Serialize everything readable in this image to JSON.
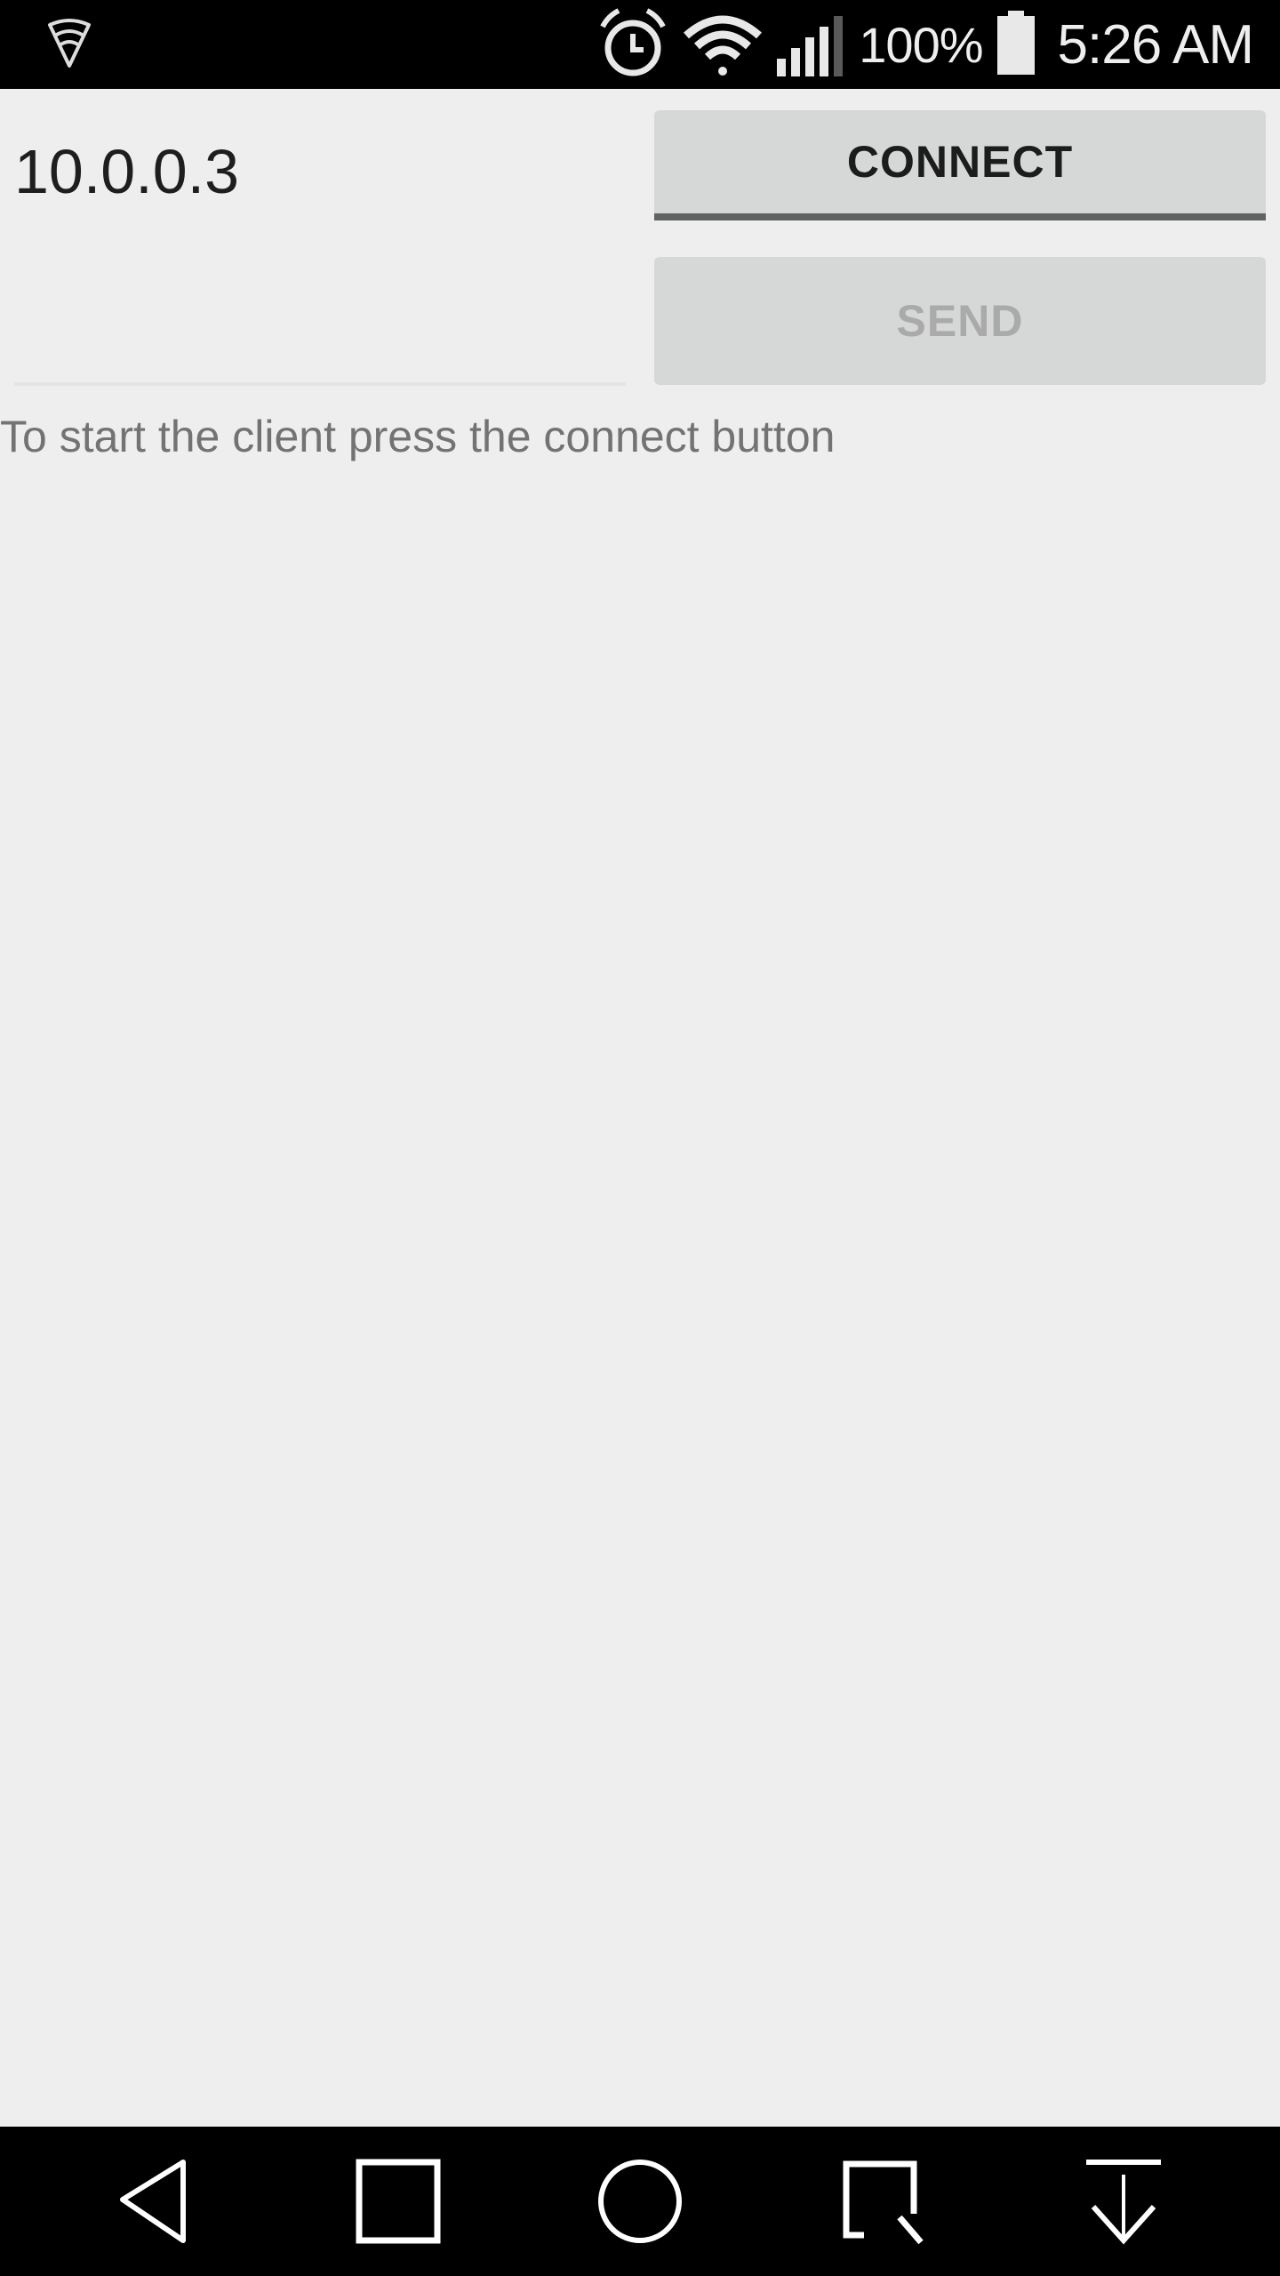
{
  "status_bar": {
    "left_icon": "lookout-shield-icon",
    "icons": [
      "alarm-clock-icon",
      "wifi-icon",
      "signal-icon",
      "battery-icon"
    ],
    "battery_percent": "100%",
    "time": "5:26 AM"
  },
  "form": {
    "ip_value": "10.0.0.3",
    "message_value": "",
    "connect_label": "CONNECT",
    "send_label": "SEND",
    "send_enabled": false
  },
  "status_message": "To start the client press the connect button",
  "nav_bar": {
    "buttons": [
      "back",
      "recents",
      "home",
      "capture",
      "notifications-pull"
    ]
  },
  "colors": {
    "background": "#eeeeee",
    "button_bg": "#d6d8d7",
    "button_underline": "#616362",
    "disabled_text": "#a9aaa9",
    "status_text": "#737373"
  }
}
